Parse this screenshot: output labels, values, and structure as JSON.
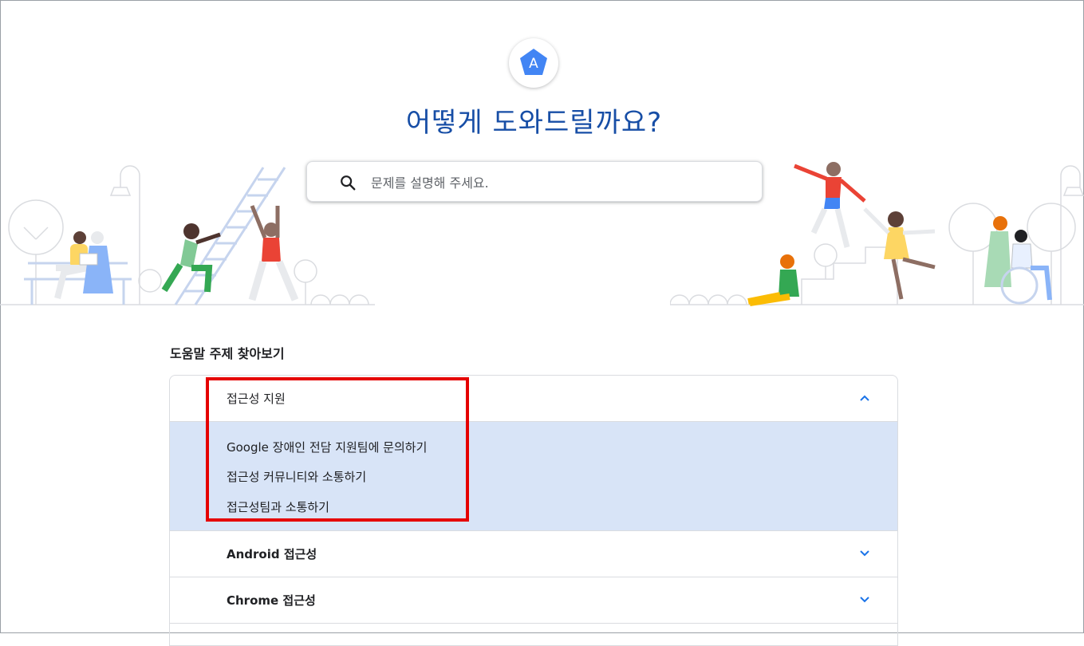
{
  "logo": {
    "letter": "A",
    "color": "#4285f4"
  },
  "page": {
    "title": "어떻게 도와드릴까요?"
  },
  "search": {
    "placeholder": "문제를 설명해 주세요.",
    "icon": "search-icon"
  },
  "topics": {
    "heading": "도움말 주제 찾아보기",
    "sections": [
      {
        "label": "접근성 지원",
        "expanded": true,
        "links": [
          "Google 장애인 전담 지원팀에 문의하기",
          "접근성 커뮤니티와 소통하기",
          "접근성팀과 소통하기"
        ]
      },
      {
        "label": "Android 접근성",
        "expanded": false
      },
      {
        "label": "Chrome 접근성",
        "expanded": false
      }
    ]
  },
  "colors": {
    "title": "#174ea6",
    "expanded_bg": "#d8e4f7",
    "chevron": "#1a73e8",
    "highlight_box": "#e50000"
  }
}
